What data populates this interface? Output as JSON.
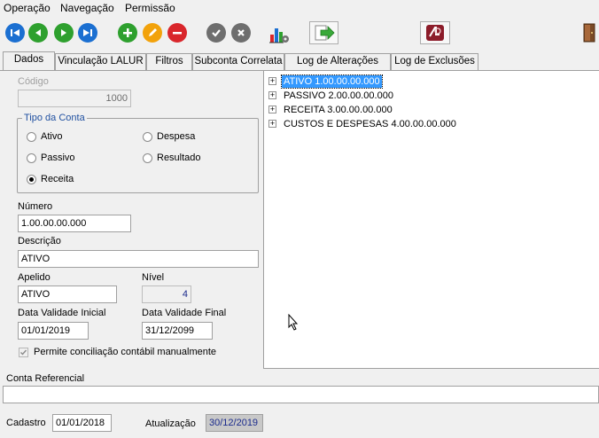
{
  "menu": [
    "Operação",
    "Navegação",
    "Permissão"
  ],
  "toolbar": {
    "icons": [
      "first-icon",
      "prev-icon",
      "next-icon",
      "last-icon",
      "add-icon",
      "edit-icon",
      "delete-icon",
      "confirm-icon",
      "cancel-icon",
      "chart-icon",
      "export-icon",
      "logo-icon",
      "exit-icon"
    ]
  },
  "tabs": [
    "Dados",
    "Vinculação LALUR",
    "Filtros",
    "Subconta Correlata",
    "Log de Alterações",
    "Log de Exclusões"
  ],
  "form": {
    "codigo_label": "Código",
    "codigo_value": "1000",
    "tipo_label": "Tipo da Conta",
    "tipo_options": [
      "Ativo",
      "Despesa",
      "Passivo",
      "Resultado",
      "Receita"
    ],
    "tipo_selected": "Receita",
    "numero_label": "Número",
    "numero_value": "1.00.00.00.000",
    "descricao_label": "Descrição",
    "descricao_value": "ATIVO",
    "apelido_label": "Apelido",
    "apelido_value": "ATIVO",
    "nivel_label": "Nível",
    "nivel_value": "4",
    "data_ini_label": "Data Validade Inicial",
    "data_ini_value": "01/01/2019",
    "data_fim_label": "Data Validade Final",
    "data_fim_value": "31/12/2099",
    "conciliacao_label": "Permite conciliação contábil manualmente",
    "conciliacao_checked": true
  },
  "tree": [
    {
      "label": "ATIVO 1.00.00.00.000",
      "selected": true
    },
    {
      "label": "PASSIVO 2.00.00.00.000",
      "selected": false
    },
    {
      "label": "RECEITA 3.00.00.00.000",
      "selected": false
    },
    {
      "label": "CUSTOS E DESPESAS 4.00.00.00.000",
      "selected": false
    }
  ],
  "conta_referencial": {
    "label": "Conta Referencial",
    "value": ""
  },
  "footer": {
    "cadastro_label": "Cadastro",
    "cadastro_value": "01/01/2018",
    "atualizacao_label": "Atualização",
    "atualizacao_value": "30/12/2019"
  }
}
